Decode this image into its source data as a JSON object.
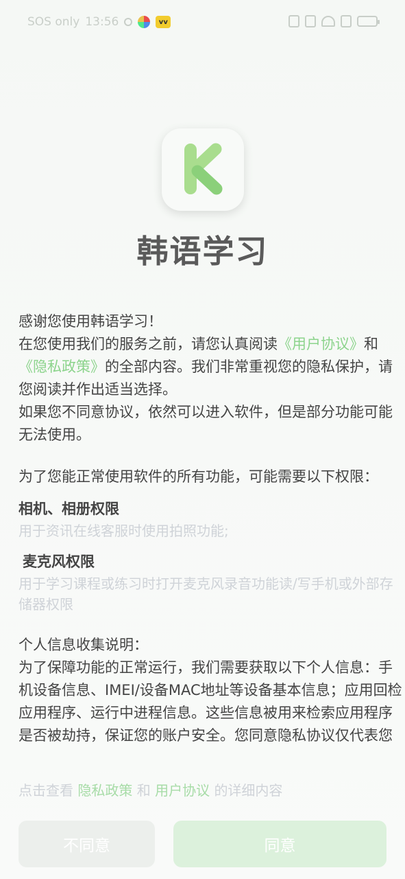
{
  "status_bar": {
    "carrier": "SOS only",
    "time": "13:56"
  },
  "app": {
    "title": "韩语学习",
    "accent_color": "#8cd48c"
  },
  "intro": {
    "line1": "感谢您使用韩语学习！",
    "line2_prefix": "在您使用我们的服务之前，请您认真阅读",
    "user_agreement_link": "《用户协议》",
    "and": "和",
    "privacy_link": "《隐私政策》",
    "line2_suffix": "的全部内容。我们非常重视您的隐私保护，请您阅读并作出适当选择。",
    "line3": "如果您不同意协议，依然可以进入软件，但是部分功能可能无法使用。"
  },
  "permissions": {
    "intro": "为了您能正常使用软件的所有功能，可能需要以下权限：",
    "items": [
      {
        "title": "相机、相册权限",
        "desc": "用于资讯在线客服时使用拍照功能;"
      },
      {
        "title": "麦克风权限",
        "desc": "用于学习课程或练习时打开麦克风录音功能读/写手机或外部存储器权限"
      }
    ]
  },
  "personal_info": {
    "title": "个人信息收集说明：",
    "body": "为了保障功能的正常运行，我们需要获取以下个人信息：手机设备信息、IMEI/设备MAC地址等设备基本信息；应用回检应用程序、运行中进程信息。这些信息被用来检索应用程序是否被劫持，保证您的账户安全。您同意隐私协议仅代表您已了解应用提供的功能和功能"
  },
  "footer": {
    "prefix": "点击查看",
    "privacy_link": "隐私政策",
    "and": "和",
    "agreement_link": "用户协议",
    "suffix": "的详细内容"
  },
  "buttons": {
    "disagree": "不同意",
    "agree": "同意"
  }
}
